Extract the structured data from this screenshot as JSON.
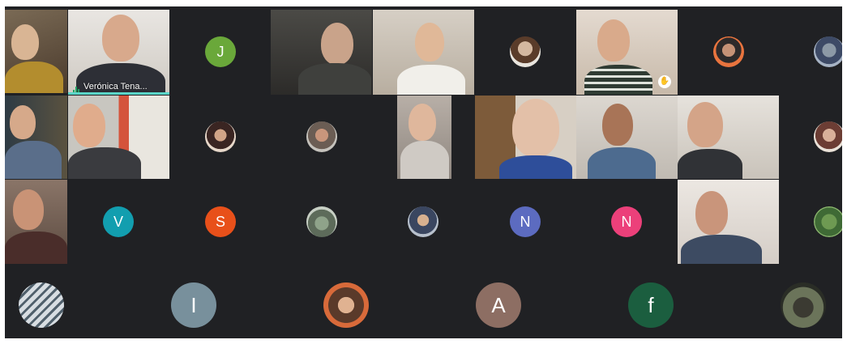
{
  "participants": {
    "veronica": {
      "name": "Verónica Tena..."
    },
    "initials": {
      "j": "J",
      "v": "V",
      "s": "S",
      "n1": "N",
      "n2": "N",
      "i": "I",
      "a": "A",
      "f": "f"
    }
  },
  "colors": {
    "background": "#202124",
    "active_speaker": "#5ad5c8",
    "avatar_j": "#6aa83a",
    "avatar_v": "#129eaf",
    "avatar_s": "#e8501a",
    "avatar_n1": "#5c6bc0",
    "avatar_n2": "#ec407a",
    "avatar_i": "#78909c",
    "avatar_a": "#8d6e63",
    "avatar_f": "#1b5e3f"
  }
}
